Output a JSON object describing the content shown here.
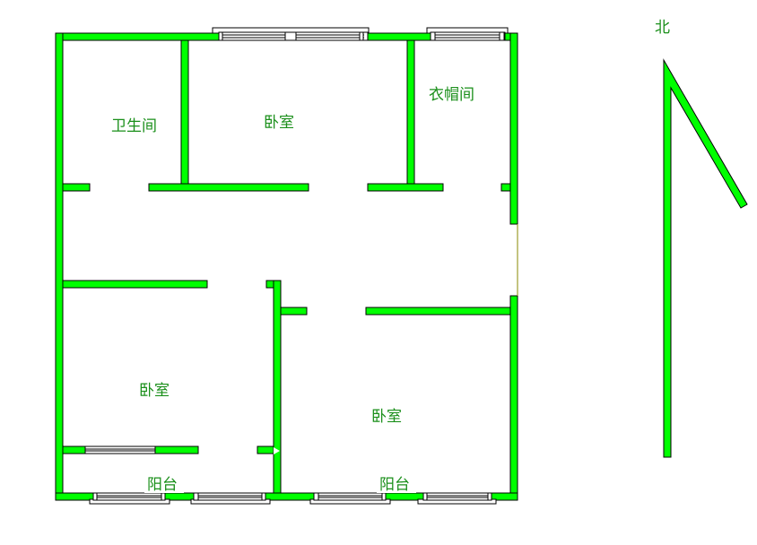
{
  "plan": {
    "rooms": [
      {
        "id": "bathroom",
        "label": "卫生间"
      },
      {
        "id": "bedroom-north",
        "label": "卧室"
      },
      {
        "id": "cloakroom",
        "label": "衣帽间"
      },
      {
        "id": "bedroom-southwest",
        "label": "卧室"
      },
      {
        "id": "bedroom-southeast",
        "label": "卧室"
      },
      {
        "id": "balcony-west",
        "label": "阳台"
      },
      {
        "id": "balcony-east",
        "label": "阳台"
      }
    ],
    "compass": {
      "label": "北"
    },
    "colors": {
      "wall": "#00ff00",
      "outline": "#000000",
      "text": "#1a8f1a"
    }
  }
}
